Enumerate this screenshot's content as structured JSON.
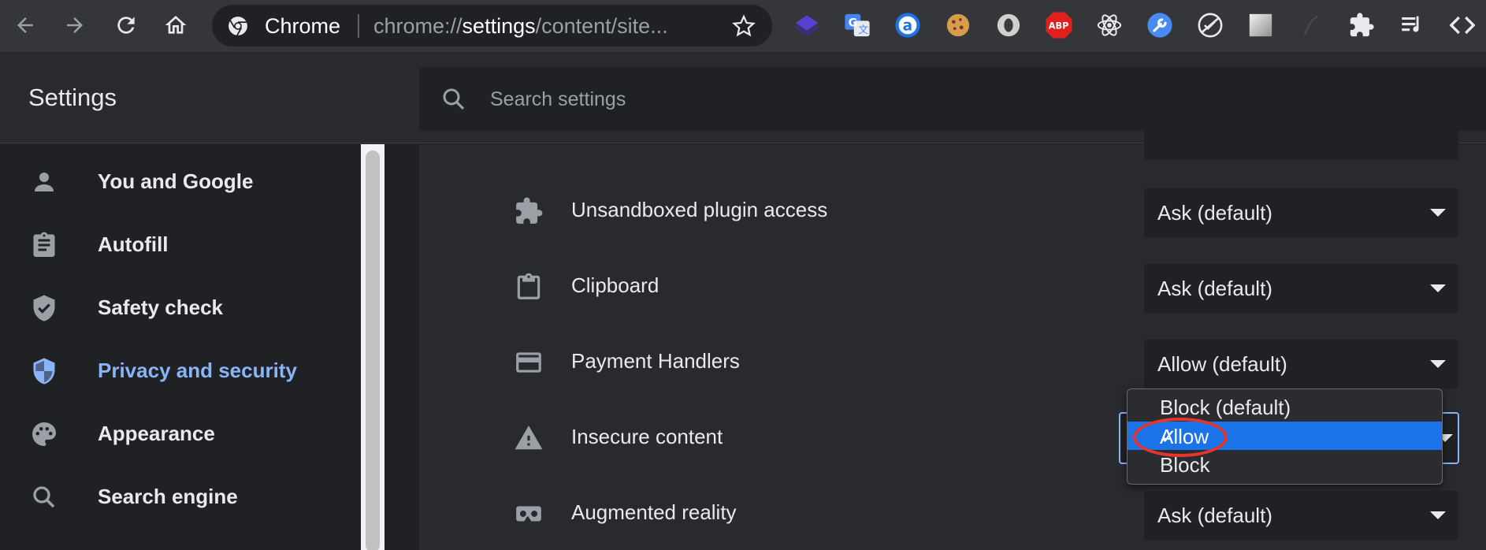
{
  "toolbar": {
    "site_name": "Chrome",
    "url_prefix": "chrome://",
    "url_host": "settings",
    "url_rest": "/content/site..."
  },
  "header": {
    "title": "Settings",
    "search_placeholder": "Search settings"
  },
  "sidebar": {
    "items": [
      {
        "label": "You and Google",
        "icon": "person-icon"
      },
      {
        "label": "Autofill",
        "icon": "clipboard-list-icon"
      },
      {
        "label": "Safety check",
        "icon": "shield-check-icon"
      },
      {
        "label": "Privacy and security",
        "icon": "shield-icon",
        "active": true
      },
      {
        "label": "Appearance",
        "icon": "palette-icon"
      },
      {
        "label": "Search engine",
        "icon": "search-icon"
      }
    ]
  },
  "permissions": [
    {
      "label": "Unsandboxed plugin access",
      "value": "Ask (default)",
      "icon": "puzzle-icon"
    },
    {
      "label": "Clipboard",
      "value": "Ask (default)",
      "icon": "clipboard-icon"
    },
    {
      "label": "Payment Handlers",
      "value": "Allow (default)",
      "icon": "credit-card-icon"
    },
    {
      "label": "Insecure content",
      "value": "Allow",
      "icon": "warning-icon"
    },
    {
      "label": "Augmented reality",
      "value": "Ask (default)",
      "icon": "vr-headset-icon"
    }
  ],
  "dropdown": {
    "options": [
      "Block (default)",
      "Allow",
      "Block"
    ],
    "selected": "Allow",
    "check_mark": "✓"
  },
  "colors": {
    "accent": "#8ab4f8",
    "selection": "#1a73e8",
    "annotation": "#e8352c"
  }
}
